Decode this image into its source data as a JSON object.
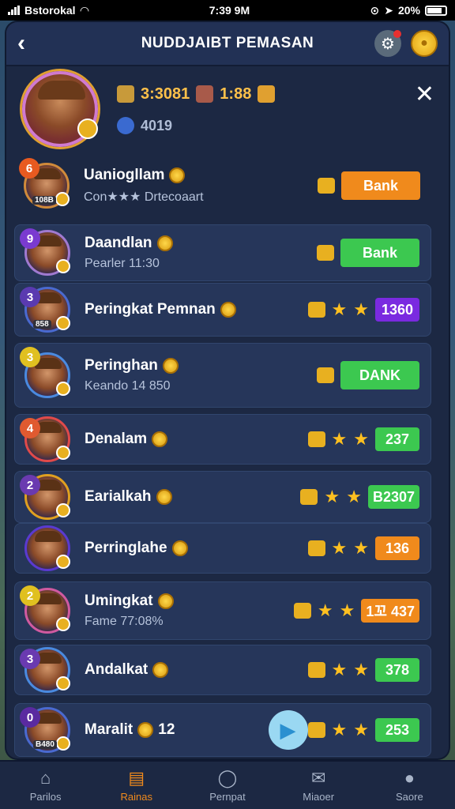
{
  "status_bar": {
    "carrier": "Bstorokal",
    "time": "7:39 9M",
    "battery": "20%"
  },
  "header": {
    "title": "NUDDJAIBT PEMASAN"
  },
  "profile": {
    "currency_1": "3:3081",
    "currency_2": "1:88",
    "level": "4019"
  },
  "rows": [
    {
      "rank": "6",
      "name": "Uaniogllam",
      "sub": "Con★★★ Drtecoaart",
      "avatar_tag": "108B",
      "action": "Bank",
      "action_kind": "orange",
      "icon": "a"
    },
    {
      "rank": "9",
      "name": "Daandlan",
      "sub": "Pearler 11:30",
      "action": "Bank",
      "action_kind": "green"
    },
    {
      "rank": "3",
      "name": "Peringkat Pemnan",
      "avatar_tag": "858",
      "score": "1360",
      "score_kind": "purple"
    },
    {
      "rank": "3",
      "name": "Peringhan",
      "sub": "Keando 14 850",
      "action": "DANK",
      "action_kind": "green"
    },
    {
      "rank": "4",
      "name": "Denalam",
      "score": "237",
      "score_kind": "green"
    },
    {
      "rank": "2",
      "name": "Earialkah",
      "score": "B2307",
      "score_kind": "green"
    },
    {
      "rank": "",
      "name": "Perringlahe",
      "score": "136",
      "score_kind": "orange"
    },
    {
      "rank": "2",
      "name": "Umingkat",
      "sub": "Fame 77:08%",
      "score": "1꼬 437",
      "score_kind": "orange"
    },
    {
      "rank": "3",
      "name": "Andalkat",
      "score": "378",
      "score_kind": "green"
    },
    {
      "rank": "0",
      "name": "Maralit",
      "name_suffix": "12",
      "avatar_tag": "B480",
      "score": "253",
      "score_kind": "green"
    }
  ],
  "nav": [
    {
      "label": "Parilos",
      "icon": "home-icon"
    },
    {
      "label": "Rainas",
      "icon": "ranking-icon",
      "active": true
    },
    {
      "label": "Pernpat",
      "icon": "chat-icon"
    },
    {
      "label": "Miaoer",
      "icon": "mail-icon"
    },
    {
      "label": "Saore",
      "icon": "profile-icon"
    }
  ],
  "colors": {
    "panel": "#1c2843",
    "orange": "#f08a1c",
    "green": "#3cc850",
    "purple": "#7a2ae0",
    "gold": "#ffc14a"
  }
}
